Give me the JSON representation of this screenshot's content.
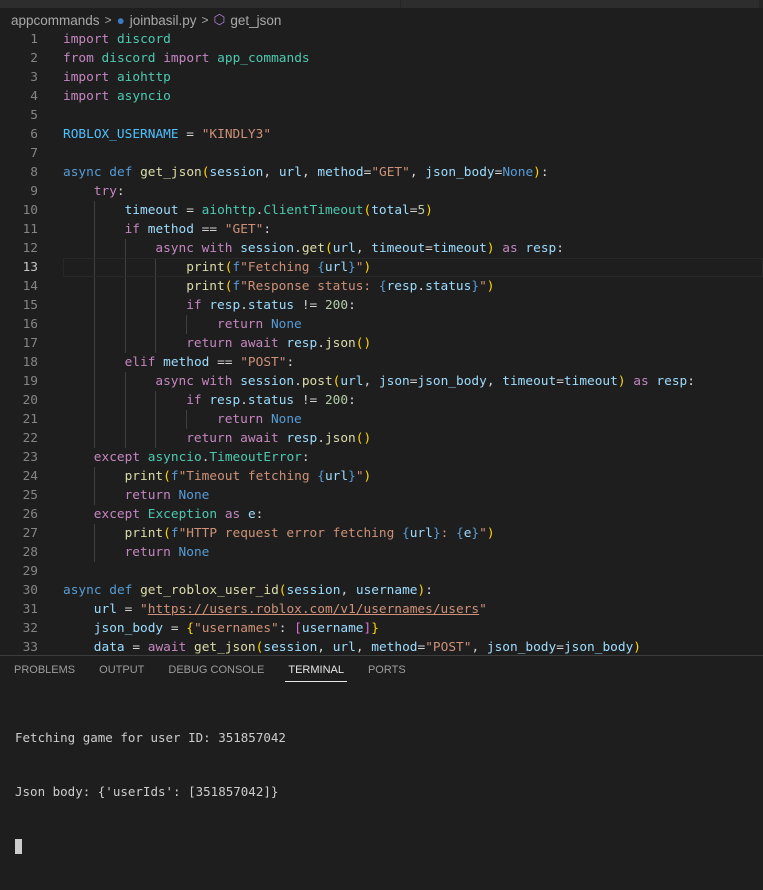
{
  "breadcrumb": {
    "folder": "appcommands",
    "file": "joinbasil.py",
    "symbol": "get_json"
  },
  "current_line": 13,
  "code": [
    [
      [
        "k",
        "import"
      ],
      [
        "p",
        " "
      ],
      [
        "t",
        "discord"
      ]
    ],
    [
      [
        "k",
        "from"
      ],
      [
        "p",
        " "
      ],
      [
        "t",
        "discord"
      ],
      [
        "p",
        " "
      ],
      [
        "k",
        "import"
      ],
      [
        "p",
        " "
      ],
      [
        "t",
        "app_commands"
      ]
    ],
    [
      [
        "k",
        "import"
      ],
      [
        "p",
        " "
      ],
      [
        "t",
        "aiohttp"
      ]
    ],
    [
      [
        "k",
        "import"
      ],
      [
        "p",
        " "
      ],
      [
        "t",
        "asyncio"
      ]
    ],
    [],
    [
      [
        "c",
        "ROBLOX_USERNAME"
      ],
      [
        "p",
        " = "
      ],
      [
        "str",
        "\"KINDLY3\""
      ]
    ],
    [],
    [
      [
        "s",
        "async"
      ],
      [
        "p",
        " "
      ],
      [
        "s",
        "def"
      ],
      [
        "p",
        " "
      ],
      [
        "f",
        "get_json"
      ],
      [
        "b1",
        "("
      ],
      [
        "v",
        "session"
      ],
      [
        "p",
        ", "
      ],
      [
        "v",
        "url"
      ],
      [
        "p",
        ", "
      ],
      [
        "v",
        "method"
      ],
      [
        "p",
        "="
      ],
      [
        "str",
        "\"GET\""
      ],
      [
        "p",
        ", "
      ],
      [
        "v",
        "json_body"
      ],
      [
        "p",
        "="
      ],
      [
        "s",
        "None"
      ],
      [
        "b1",
        ")"
      ],
      [
        "p",
        ":"
      ]
    ],
    [
      [
        "i",
        1
      ],
      [
        "k",
        "try"
      ],
      [
        "p",
        ":"
      ]
    ],
    [
      [
        "i",
        2
      ],
      [
        "v",
        "timeout"
      ],
      [
        "p",
        " = "
      ],
      [
        "t",
        "aiohttp"
      ],
      [
        "p",
        "."
      ],
      [
        "t",
        "ClientTimeout"
      ],
      [
        "b1",
        "("
      ],
      [
        "v",
        "total"
      ],
      [
        "p",
        "="
      ],
      [
        "n",
        "5"
      ],
      [
        "b1",
        ")"
      ]
    ],
    [
      [
        "i",
        2
      ],
      [
        "k",
        "if"
      ],
      [
        "p",
        " "
      ],
      [
        "v",
        "method"
      ],
      [
        "p",
        " == "
      ],
      [
        "str",
        "\"GET\""
      ],
      [
        "p",
        ":"
      ]
    ],
    [
      [
        "i",
        3
      ],
      [
        "k",
        "async"
      ],
      [
        "p",
        " "
      ],
      [
        "k",
        "with"
      ],
      [
        "p",
        " "
      ],
      [
        "v",
        "session"
      ],
      [
        "p",
        "."
      ],
      [
        "f",
        "get"
      ],
      [
        "b1",
        "("
      ],
      [
        "v",
        "url"
      ],
      [
        "p",
        ", "
      ],
      [
        "v",
        "timeout"
      ],
      [
        "p",
        "="
      ],
      [
        "v",
        "timeout"
      ],
      [
        "b1",
        ")"
      ],
      [
        "p",
        " "
      ],
      [
        "k",
        "as"
      ],
      [
        "p",
        " "
      ],
      [
        "v",
        "resp"
      ],
      [
        "p",
        ":"
      ]
    ],
    [
      [
        "i",
        4
      ],
      [
        "f",
        "print"
      ],
      [
        "b1",
        "("
      ],
      [
        "s",
        "f"
      ],
      [
        "str",
        "\"Fetching "
      ],
      [
        "s",
        "{"
      ],
      [
        "v",
        "url"
      ],
      [
        "s",
        "}"
      ],
      [
        "str",
        "\""
      ],
      [
        "b1",
        ")"
      ]
    ],
    [
      [
        "i",
        4
      ],
      [
        "f",
        "print"
      ],
      [
        "b1",
        "("
      ],
      [
        "s",
        "f"
      ],
      [
        "str",
        "\"Response status: "
      ],
      [
        "s",
        "{"
      ],
      [
        "v",
        "resp"
      ],
      [
        "p",
        "."
      ],
      [
        "v",
        "status"
      ],
      [
        "s",
        "}"
      ],
      [
        "str",
        "\""
      ],
      [
        "b1",
        ")"
      ]
    ],
    [
      [
        "i",
        4
      ],
      [
        "k",
        "if"
      ],
      [
        "p",
        " "
      ],
      [
        "v",
        "resp"
      ],
      [
        "p",
        "."
      ],
      [
        "v",
        "status"
      ],
      [
        "p",
        " != "
      ],
      [
        "n",
        "200"
      ],
      [
        "p",
        ":"
      ]
    ],
    [
      [
        "i",
        5
      ],
      [
        "k",
        "return"
      ],
      [
        "p",
        " "
      ],
      [
        "s",
        "None"
      ]
    ],
    [
      [
        "i",
        4
      ],
      [
        "k",
        "return"
      ],
      [
        "p",
        " "
      ],
      [
        "k",
        "await"
      ],
      [
        "p",
        " "
      ],
      [
        "v",
        "resp"
      ],
      [
        "p",
        "."
      ],
      [
        "f",
        "json"
      ],
      [
        "b1",
        "()"
      ]
    ],
    [
      [
        "i",
        2
      ],
      [
        "k",
        "elif"
      ],
      [
        "p",
        " "
      ],
      [
        "v",
        "method"
      ],
      [
        "p",
        " == "
      ],
      [
        "str",
        "\"POST\""
      ],
      [
        "p",
        ":"
      ]
    ],
    [
      [
        "i",
        3
      ],
      [
        "k",
        "async"
      ],
      [
        "p",
        " "
      ],
      [
        "k",
        "with"
      ],
      [
        "p",
        " "
      ],
      [
        "v",
        "session"
      ],
      [
        "p",
        "."
      ],
      [
        "f",
        "post"
      ],
      [
        "b1",
        "("
      ],
      [
        "v",
        "url"
      ],
      [
        "p",
        ", "
      ],
      [
        "v",
        "json"
      ],
      [
        "p",
        "="
      ],
      [
        "v",
        "json_body"
      ],
      [
        "p",
        ", "
      ],
      [
        "v",
        "timeout"
      ],
      [
        "p",
        "="
      ],
      [
        "v",
        "timeout"
      ],
      [
        "b1",
        ")"
      ],
      [
        "p",
        " "
      ],
      [
        "k",
        "as"
      ],
      [
        "p",
        " "
      ],
      [
        "v",
        "resp"
      ],
      [
        "p",
        ":"
      ]
    ],
    [
      [
        "i",
        4
      ],
      [
        "k",
        "if"
      ],
      [
        "p",
        " "
      ],
      [
        "v",
        "resp"
      ],
      [
        "p",
        "."
      ],
      [
        "v",
        "status"
      ],
      [
        "p",
        " != "
      ],
      [
        "n",
        "200"
      ],
      [
        "p",
        ":"
      ]
    ],
    [
      [
        "i",
        5
      ],
      [
        "k",
        "return"
      ],
      [
        "p",
        " "
      ],
      [
        "s",
        "None"
      ]
    ],
    [
      [
        "i",
        4
      ],
      [
        "k",
        "return"
      ],
      [
        "p",
        " "
      ],
      [
        "k",
        "await"
      ],
      [
        "p",
        " "
      ],
      [
        "v",
        "resp"
      ],
      [
        "p",
        "."
      ],
      [
        "f",
        "json"
      ],
      [
        "b1",
        "()"
      ]
    ],
    [
      [
        "i",
        1
      ],
      [
        "k",
        "except"
      ],
      [
        "p",
        " "
      ],
      [
        "t",
        "asyncio"
      ],
      [
        "p",
        "."
      ],
      [
        "t",
        "TimeoutError"
      ],
      [
        "p",
        ":"
      ]
    ],
    [
      [
        "i",
        2
      ],
      [
        "f",
        "print"
      ],
      [
        "b1",
        "("
      ],
      [
        "s",
        "f"
      ],
      [
        "str",
        "\"Timeout fetching "
      ],
      [
        "s",
        "{"
      ],
      [
        "v",
        "url"
      ],
      [
        "s",
        "}"
      ],
      [
        "str",
        "\""
      ],
      [
        "b1",
        ")"
      ]
    ],
    [
      [
        "i",
        2
      ],
      [
        "k",
        "return"
      ],
      [
        "p",
        " "
      ],
      [
        "s",
        "None"
      ]
    ],
    [
      [
        "i",
        1
      ],
      [
        "k",
        "except"
      ],
      [
        "p",
        " "
      ],
      [
        "t",
        "Exception"
      ],
      [
        "p",
        " "
      ],
      [
        "k",
        "as"
      ],
      [
        "p",
        " "
      ],
      [
        "v",
        "e"
      ],
      [
        "p",
        ":"
      ]
    ],
    [
      [
        "i",
        2
      ],
      [
        "f",
        "print"
      ],
      [
        "b1",
        "("
      ],
      [
        "s",
        "f"
      ],
      [
        "str",
        "\"HTTP request error fetching "
      ],
      [
        "s",
        "{"
      ],
      [
        "v",
        "url"
      ],
      [
        "s",
        "}"
      ],
      [
        "str",
        ": "
      ],
      [
        "s",
        "{"
      ],
      [
        "v",
        "e"
      ],
      [
        "s",
        "}"
      ],
      [
        "str",
        "\""
      ],
      [
        "b1",
        ")"
      ]
    ],
    [
      [
        "i",
        2
      ],
      [
        "k",
        "return"
      ],
      [
        "p",
        " "
      ],
      [
        "s",
        "None"
      ]
    ],
    [],
    [
      [
        "s",
        "async"
      ],
      [
        "p",
        " "
      ],
      [
        "s",
        "def"
      ],
      [
        "p",
        " "
      ],
      [
        "f",
        "get_roblox_user_id"
      ],
      [
        "b1",
        "("
      ],
      [
        "v",
        "session"
      ],
      [
        "p",
        ", "
      ],
      [
        "v",
        "username"
      ],
      [
        "b1",
        ")"
      ],
      [
        "p",
        ":"
      ]
    ],
    [
      [
        "i",
        1
      ],
      [
        "v",
        "url"
      ],
      [
        "p",
        " = "
      ],
      [
        "str",
        "\""
      ],
      [
        "u",
        "https://users.roblox.com/v1/usernames/users"
      ],
      [
        "str",
        "\""
      ]
    ],
    [
      [
        "i",
        1
      ],
      [
        "v",
        "json_body"
      ],
      [
        "p",
        " = "
      ],
      [
        "b1",
        "{"
      ],
      [
        "str",
        "\"usernames\""
      ],
      [
        "p",
        ": "
      ],
      [
        "b2",
        "["
      ],
      [
        "v",
        "username"
      ],
      [
        "b2",
        "]"
      ],
      [
        "b1",
        "}"
      ]
    ],
    [
      [
        "i",
        1
      ],
      [
        "v",
        "data"
      ],
      [
        "p",
        " = "
      ],
      [
        "k",
        "await"
      ],
      [
        "p",
        " "
      ],
      [
        "f",
        "get_json"
      ],
      [
        "b1",
        "("
      ],
      [
        "v",
        "session"
      ],
      [
        "p",
        ", "
      ],
      [
        "v",
        "url"
      ],
      [
        "p",
        ", "
      ],
      [
        "v",
        "method"
      ],
      [
        "p",
        "="
      ],
      [
        "str",
        "\"POST\""
      ],
      [
        "p",
        ", "
      ],
      [
        "v",
        "json_body"
      ],
      [
        "p",
        "="
      ],
      [
        "v",
        "json_body"
      ],
      [
        "b1",
        ")"
      ]
    ]
  ],
  "panel": {
    "tabs": [
      "PROBLEMS",
      "OUTPUT",
      "DEBUG CONSOLE",
      "TERMINAL",
      "PORTS"
    ],
    "active_tab": "TERMINAL"
  },
  "terminal": {
    "lines": [
      "Fetching game for user ID: 351857042",
      "Json body: {'userIds': [351857042]}"
    ]
  }
}
